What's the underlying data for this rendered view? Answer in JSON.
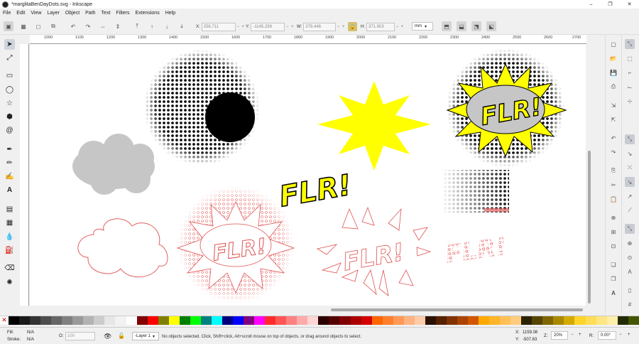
{
  "window": {
    "title": "*marglitaBenDayDots.svg - Inkscape",
    "controls": [
      "–",
      "❐",
      "✕"
    ]
  },
  "menu": [
    "File",
    "Edit",
    "View",
    "Layer",
    "Object",
    "Path",
    "Text",
    "Filters",
    "Extensions",
    "Help"
  ],
  "toolbar": {
    "x_label": "X:",
    "x_value": "256.711",
    "y_label": "Y:",
    "y_value": "-1145.299",
    "w_label": "W:",
    "w_value": "379.446",
    "h_label": "H:",
    "h_value": "371.903",
    "unit": "mm",
    "plus": "+",
    "minus": "−"
  },
  "ruler": {
    "ticks": [
      "1000",
      "1100",
      "1200",
      "1300",
      "1400",
      "1500",
      "1600",
      "1700",
      "1800",
      "1900",
      "2000",
      "2100",
      "2200",
      "2300",
      "2400",
      "2500",
      "2600",
      "2700"
    ]
  },
  "canvas": {
    "flr_text": "FLR!"
  },
  "palette": {
    "none_glyph": "✕",
    "colors": [
      "#000000",
      "#1a1a1a",
      "#333333",
      "#4d4d4d",
      "#666666",
      "#808080",
      "#999999",
      "#b3b3b3",
      "#cccccc",
      "#e6e6e6",
      "#f2f2f2",
      "#ffffff",
      "#800000",
      "#ff0000",
      "#808000",
      "#ffff00",
      "#008000",
      "#00ff00",
      "#008080",
      "#00ffff",
      "#000080",
      "#0000ff",
      "#800080",
      "#ff00ff",
      "#ff2a2a",
      "#ff5555",
      "#ff8080",
      "#ffaaaa",
      "#ffd5d5",
      "#2b0000",
      "#550000",
      "#800000",
      "#aa0000",
      "#d40000",
      "#ff6600",
      "#ff7f2a",
      "#ff9955",
      "#ffb380",
      "#ffccaa",
      "#2b1100",
      "#552200",
      "#803300",
      "#aa4400",
      "#d45500",
      "#ffaa00",
      "#ffb52a",
      "#ffc155",
      "#ffcc80",
      "#2b2200",
      "#554400",
      "#806600",
      "#aa8800",
      "#d4aa00",
      "#ffd42a",
      "#ffdd55",
      "#ffe680",
      "#ffeeaa",
      "#222b00",
      "#445500"
    ]
  },
  "status": {
    "fill_label": "Fill:",
    "fill_value": "N/A",
    "stroke_label": "Stroke:",
    "stroke_value": "N/A",
    "opacity_label": "O:",
    "opacity_value": "100",
    "layer": "-Layer 1",
    "message": "No objects selected. Click, Shift+click, Alt+scroll mouse on top of objects, or drag around objects to select.",
    "x_label": "X:",
    "x_value": "1159.08",
    "y_label": "Y:",
    "y_value": "-507.63",
    "z_label": "Z:",
    "zoom": "20%",
    "r_label": "R:",
    "rotation": "0.00°"
  }
}
